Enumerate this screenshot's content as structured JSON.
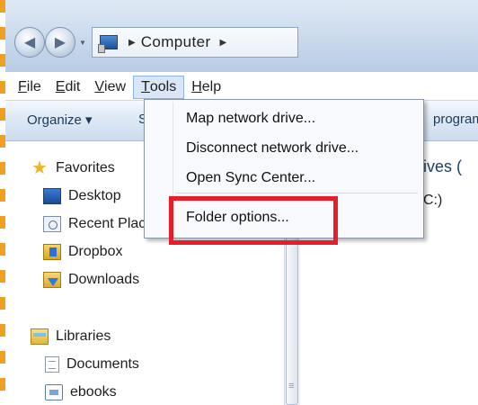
{
  "address_bar": {
    "location": "Computer"
  },
  "menubar": {
    "items": [
      {
        "label": "File",
        "key": "F",
        "rest": "ile"
      },
      {
        "label": "Edit",
        "key": "E",
        "rest": "dit"
      },
      {
        "label": "View",
        "key": "V",
        "rest": "iew"
      },
      {
        "label": "Tools",
        "key": "T",
        "rest": "ools"
      },
      {
        "label": "Help",
        "key": "H",
        "rest": "elp"
      }
    ],
    "active": "Tools"
  },
  "toolbar": {
    "organize_label": "Organize ▾",
    "share_fragment": "S",
    "programs_fragment": "program"
  },
  "tools_menu": {
    "items": [
      {
        "label": "Map network drive..."
      },
      {
        "label": "Disconnect network drive..."
      },
      {
        "label": "Open Sync Center..."
      },
      {
        "label": "Folder options..."
      }
    ],
    "highlighted_item": "Folder options..."
  },
  "navigation_pane": {
    "favorites_header": "Favorites",
    "favorites": [
      {
        "label": "Desktop",
        "icon": "desktop-icon"
      },
      {
        "label": "Recent Plac",
        "icon": "recent-places-icon"
      },
      {
        "label": "Dropbox",
        "icon": "dropbox-icon"
      },
      {
        "label": "Downloads",
        "icon": "downloads-icon"
      }
    ],
    "libraries_header": "Libraries",
    "libraries": [
      {
        "label": "Documents",
        "icon": "documents-icon"
      },
      {
        "label": "ebooks",
        "icon": "ebooks-icon"
      }
    ]
  },
  "content": {
    "drives_fragment": "rives (",
    "drive_c_fragment": "C:)"
  },
  "colors": {
    "highlight_box": "#e81d2a",
    "edge_dashes": "#f0a020",
    "menu_active_bg": "#d8e6f8"
  }
}
